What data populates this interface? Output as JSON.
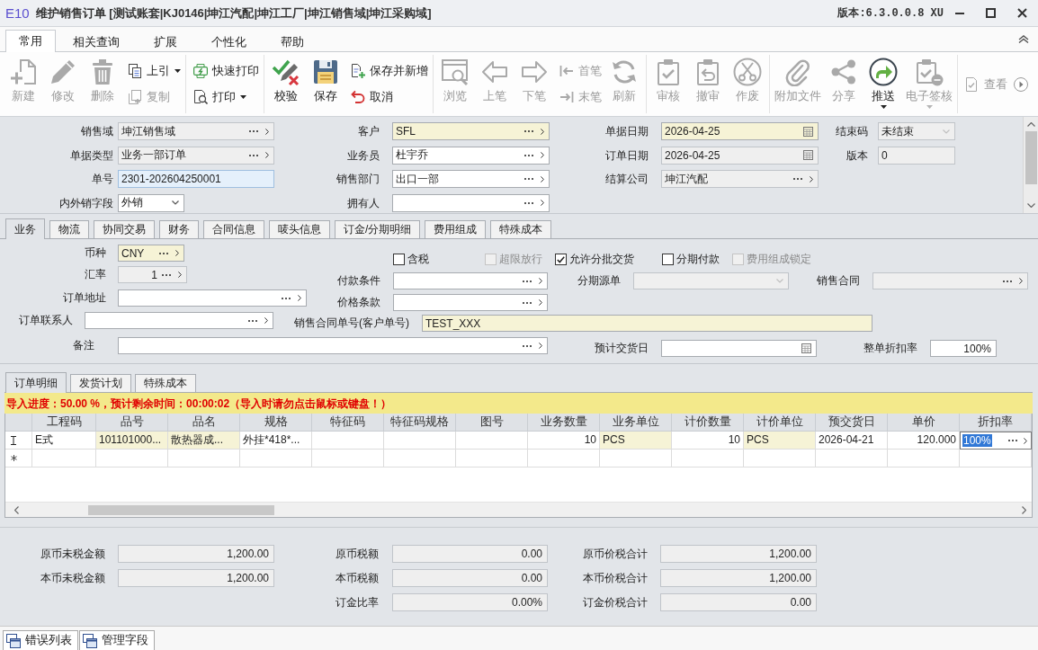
{
  "window": {
    "logo": "E10",
    "title": "维护销售订单 [测试账套|KJ0146|坤江汽配|坤江工厂|坤江销售域|坤江采购域]",
    "version": "版本:6.3.0.0.8 XU"
  },
  "ribbon_tabs": [
    {
      "label": "常用",
      "selected": true
    },
    {
      "label": "相关查询",
      "selected": false
    },
    {
      "label": "扩展",
      "selected": false
    },
    {
      "label": "个性化",
      "selected": false
    },
    {
      "label": "帮助",
      "selected": false
    }
  ],
  "toolbar": [
    {
      "items": [
        {
          "label": "新建",
          "kind": "large",
          "disabled": true,
          "dropdown": false
        },
        {
          "label": "修改",
          "kind": "large",
          "disabled": true,
          "dropdown": false
        },
        {
          "label": "删除",
          "kind": "large",
          "disabled": true,
          "dropdown": false
        },
        {
          "label": "上引",
          "kind": "small",
          "disabled": false,
          "dropdown": true
        },
        {
          "label": "复制",
          "kind": "small",
          "disabled": true,
          "dropdown": false
        }
      ]
    },
    {
      "items": [
        {
          "label": "快速打印",
          "kind": "small",
          "disabled": false,
          "dropdown": false
        },
        {
          "label": "打印",
          "kind": "small",
          "disabled": false,
          "dropdown": true
        }
      ]
    },
    {
      "items": [
        {
          "label": "校验",
          "kind": "large",
          "disabled": false,
          "dropdown": false
        },
        {
          "label": "保存",
          "kind": "large",
          "disabled": false,
          "dropdown": false
        },
        {
          "label": "保存并新增",
          "kind": "small",
          "disabled": false,
          "dropdown": false
        },
        {
          "label": "取消",
          "kind": "small",
          "disabled": false,
          "dropdown": false
        }
      ]
    },
    {
      "items": [
        {
          "label": "浏览",
          "kind": "large",
          "disabled": true,
          "dropdown": false
        },
        {
          "label": "上笔",
          "kind": "large",
          "disabled": true,
          "dropdown": false
        },
        {
          "label": "下笔",
          "kind": "large",
          "disabled": true,
          "dropdown": false
        },
        {
          "label": "首笔",
          "kind": "small",
          "disabled": true,
          "dropdown": false
        },
        {
          "label": "末笔",
          "kind": "small",
          "disabled": true,
          "dropdown": false
        },
        {
          "label": "刷新",
          "kind": "large",
          "disabled": true,
          "dropdown": false
        }
      ]
    },
    {
      "items": [
        {
          "label": "审核",
          "kind": "large",
          "disabled": true,
          "dropdown": false
        },
        {
          "label": "撤审",
          "kind": "large",
          "disabled": true,
          "dropdown": false
        },
        {
          "label": "作废",
          "kind": "large",
          "disabled": true,
          "dropdown": false
        }
      ]
    },
    {
      "items": [
        {
          "label": "附加文件",
          "kind": "large",
          "disabled": true,
          "dropdown": false
        },
        {
          "label": "分享",
          "kind": "large",
          "disabled": true,
          "dropdown": false
        },
        {
          "label": "推送",
          "kind": "large",
          "disabled": false,
          "dropdown": true
        },
        {
          "label": "电子签核",
          "kind": "large",
          "disabled": true,
          "dropdown": true
        }
      ]
    },
    {
      "items": [
        {
          "label": "查看",
          "kind": "small",
          "disabled": true,
          "dropdown": false
        }
      ]
    }
  ],
  "header": {
    "rows": [
      {
        "fields": [
          {
            "label": "销售域",
            "kind": "lookup",
            "value": "坤江销售域",
            "required": false,
            "readonly": true,
            "highlighted": false
          },
          {
            "label": "客户",
            "kind": "lookup",
            "value": "SFL",
            "required": true,
            "readonly": false,
            "highlighted": false
          },
          {
            "label": "单据日期",
            "kind": "date",
            "value": "2026-04-25",
            "required": true,
            "readonly": false,
            "highlighted": false
          },
          {
            "label": "结束码",
            "kind": "dropdown",
            "value": "未结束",
            "required": false,
            "readonly": true,
            "highlighted": false
          }
        ]
      },
      {
        "fields": [
          {
            "label": "单据类型",
            "kind": "lookup",
            "value": "业务一部订单",
            "required": false,
            "readonly": true,
            "highlighted": false
          },
          {
            "label": "业务员",
            "kind": "lookup",
            "value": "杜宇乔",
            "required": false,
            "readonly": false,
            "highlighted": false
          },
          {
            "label": "订单日期",
            "kind": "date",
            "value": "2026-04-25",
            "required": false,
            "readonly": true,
            "highlighted": false
          },
          {
            "label": "版本",
            "kind": "text",
            "value": "0",
            "required": false,
            "readonly": true,
            "highlighted": false
          }
        ]
      },
      {
        "fields": [
          {
            "label": "单号",
            "kind": "text",
            "value": "2301-202604250001",
            "required": false,
            "readonly": false,
            "highlighted": true
          },
          {
            "label": "销售部门",
            "kind": "lookup",
            "value": "出口一部",
            "required": false,
            "readonly": false,
            "highlighted": false
          },
          {
            "label": "结算公司",
            "kind": "lookup",
            "value": "坤江汽配",
            "required": false,
            "readonly": true,
            "highlighted": false
          }
        ]
      },
      {
        "fields": [
          {
            "label": "内外销字段",
            "kind": "dropdown",
            "value": "外销",
            "required": false,
            "readonly": false,
            "highlighted": false
          },
          {
            "label": "拥有人",
            "kind": "lookup",
            "required": false,
            "readonly": false,
            "highlighted": false
          }
        ]
      }
    ]
  },
  "detail_tabs": [
    {
      "label": "业务",
      "selected": true
    },
    {
      "label": "物流",
      "selected": false
    },
    {
      "label": "协同交易",
      "selected": false
    },
    {
      "label": "财务",
      "selected": false
    },
    {
      "label": "合同信息",
      "selected": false
    },
    {
      "label": "唛头信息",
      "selected": false
    },
    {
      "label": "订金/分期明细",
      "selected": false
    },
    {
      "label": "费用组成",
      "selected": false
    },
    {
      "label": "特殊成本",
      "selected": false
    }
  ],
  "business": {
    "rows": [
      {
        "items": [
          {
            "label": "币种",
            "kind": "lookup",
            "value": "CNY",
            "required": true,
            "readonly": false,
            "highlighted": false
          }
        ],
        "checkboxes": [
          {
            "label": "含税",
            "checked": false,
            "disabled": false
          },
          {
            "label": "超限放行",
            "checked": false,
            "disabled": true
          },
          {
            "label": "允许分批交货",
            "checked": true,
            "disabled": false
          },
          {
            "label": "分期付款",
            "checked": false,
            "disabled": false
          },
          {
            "label": "费用组成锁定",
            "checked": false,
            "disabled": true
          }
        ]
      },
      {
        "items": [
          {
            "label": "汇率",
            "kind": "number_lookup",
            "value": "1",
            "required": false,
            "readonly": true,
            "highlighted": false
          },
          {
            "label": "付款条件",
            "kind": "lookup",
            "required": false,
            "readonly": false,
            "highlighted": false
          },
          {
            "label": "分期源单",
            "kind": "dropdown",
            "required": false,
            "readonly": true,
            "highlighted": false
          },
          {
            "label": "销售合同",
            "kind": "lookup",
            "required": false,
            "readonly": true,
            "highlighted": false
          }
        ]
      },
      {
        "items": [
          {
            "label": "订单地址",
            "kind": "lookup",
            "required": false,
            "readonly": false,
            "highlighted": false
          },
          {
            "label": "价格条款",
            "kind": "lookup",
            "required": false,
            "readonly": false,
            "highlighted": false
          }
        ]
      },
      {
        "items": [
          {
            "label": "订单联系人",
            "kind": "lookup",
            "required": false,
            "readonly": false,
            "highlighted": false
          },
          {
            "label": "销售合同单号(客户单号)",
            "kind": "text",
            "value": "TEST_XXX",
            "required": true,
            "readonly": false,
            "highlighted": false
          }
        ]
      },
      {
        "items": [
          {
            "label": "备注",
            "kind": "lookup",
            "required": false,
            "readonly": false,
            "highlighted": false
          },
          {
            "label": "预计交货日",
            "kind": "date",
            "required": false,
            "readonly": false,
            "highlighted": false
          },
          {
            "label": "整单折扣率",
            "kind": "number",
            "value": "100%",
            "required": false,
            "readonly": false,
            "highlighted": false
          }
        ]
      }
    ]
  },
  "grid_tabs": [
    {
      "label": "订单明细",
      "selected": true
    },
    {
      "label": "发货计划",
      "selected": false
    },
    {
      "label": "特殊成本",
      "selected": false
    }
  ],
  "import_notice": "导入进度：50.00 %，预计剩余时间：00:00:02（导入时请勿点击鼠标或键盘！）",
  "grid": {
    "columns": [
      "工程码",
      "品号",
      "品名",
      "规格",
      "特征码",
      "特征码规格",
      "图号",
      "业务数量",
      "业务单位",
      "计价数量",
      "计价单位",
      "预交货日",
      "单价",
      "折扣率"
    ],
    "rows": [
      {
        "kind": "editing",
        "cells": [
          {
            "text": "E式",
            "required": false,
            "selected": false
          },
          {
            "text": "101101000...",
            "required": true,
            "selected": false
          },
          {
            "text": "散热器成...",
            "required": true,
            "selected": false
          },
          {
            "text": "外挂*418*...",
            "required": false,
            "selected": false
          },
          {
            "required": false,
            "selected": false
          },
          {
            "required": false,
            "selected": false
          },
          {
            "required": false,
            "selected": false
          },
          {
            "text": "10",
            "required": false,
            "selected": false
          },
          {
            "text": "PCS",
            "required": true,
            "selected": false
          },
          {
            "text": "10",
            "required": false,
            "selected": false
          },
          {
            "text": "PCS",
            "required": true,
            "selected": false
          },
          {
            "text": "2026-04-21",
            "required": false,
            "selected": false
          },
          {
            "text": "120.000",
            "required": false,
            "selected": false
          },
          {
            "text": "100%",
            "required": false,
            "selected": true
          }
        ]
      },
      {
        "kind": "new"
      }
    ]
  },
  "totals": {
    "columns": [
      {
        "fields": [
          {
            "label": "原币未税金额",
            "kind": "number",
            "value": "1,200.00",
            "required": false,
            "readonly": true,
            "highlighted": false
          },
          {
            "label": "本币未税金额",
            "kind": "number",
            "value": "1,200.00",
            "required": false,
            "readonly": true,
            "highlighted": false
          }
        ]
      },
      {
        "fields": [
          {
            "label": "原币税额",
            "kind": "number",
            "value": "0.00",
            "required": false,
            "readonly": true,
            "highlighted": false
          },
          {
            "label": "本币税额",
            "kind": "number",
            "value": "0.00",
            "required": false,
            "readonly": true,
            "highlighted": false
          },
          {
            "label": "订金比率",
            "kind": "number",
            "value": "0.00%",
            "required": false,
            "readonly": true,
            "highlighted": false
          }
        ]
      },
      {
        "fields": [
          {
            "label": "原币价税合计",
            "kind": "number",
            "value": "1,200.00",
            "required": false,
            "readonly": true,
            "highlighted": false
          },
          {
            "label": "本币价税合计",
            "kind": "number",
            "value": "1,200.00",
            "required": false,
            "readonly": true,
            "highlighted": false
          },
          {
            "label": "订金价税合计",
            "kind": "number",
            "value": "0.00",
            "required": false,
            "readonly": true,
            "highlighted": false
          }
        ]
      }
    ]
  },
  "dock_tabs": [
    {
      "label": "错误列表"
    },
    {
      "label": "管理字段"
    }
  ]
}
